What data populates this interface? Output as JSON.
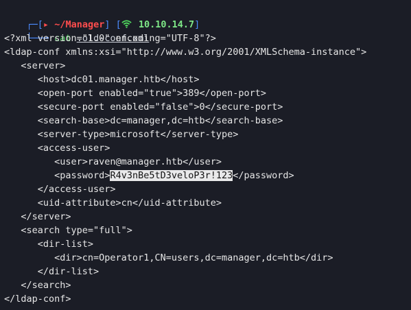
{
  "prompt": {
    "top_prefix": "┌─[",
    "arrow_icon": "▸",
    "directory": "~/Manager",
    "middle": "] [",
    "ip": "10.10.14.7",
    "close": "]",
    "bottom_prefix": "└──╼",
    "command": "cat",
    "argument": ".old-conf.xml",
    "colors": {
      "frame": "#4c8cff",
      "directory": "#ff4d4d",
      "ip": "#7ee787",
      "command": "#4fd35d"
    }
  },
  "output_lines": [
    "<?xml version=\"1.0\" encoding=\"UTF-8\"?>",
    "<ldap-conf xmlns:xsi=\"http://www.w3.org/2001/XMLSchema-instance\">",
    "   <server>",
    "      <host>dc01.manager.htb</host>",
    "      <open-port enabled=\"true\">389</open-port>",
    "      <secure-port enabled=\"false\">0</secure-port>",
    "      <search-base>dc=manager,dc=htb</search-base>",
    "      <server-type>microsoft</server-type>",
    "      <access-user>",
    "         <user>raven@manager.htb</user>"
  ],
  "password_line": {
    "before": "         <password>",
    "selected": "R4v3nBe5tD3veloP3r!123",
    "after": "</password>"
  },
  "output_lines_2": [
    "      </access-user>",
    "      <uid-attribute>cn</uid-attribute>",
    "   </server>",
    "   <search type=\"full\">",
    "      <dir-list>",
    "         <dir>cn=Operator1,CN=users,dc=manager,dc=htb</dir>",
    "      </dir-list>",
    "   </search>",
    "</ldap-conf>"
  ]
}
